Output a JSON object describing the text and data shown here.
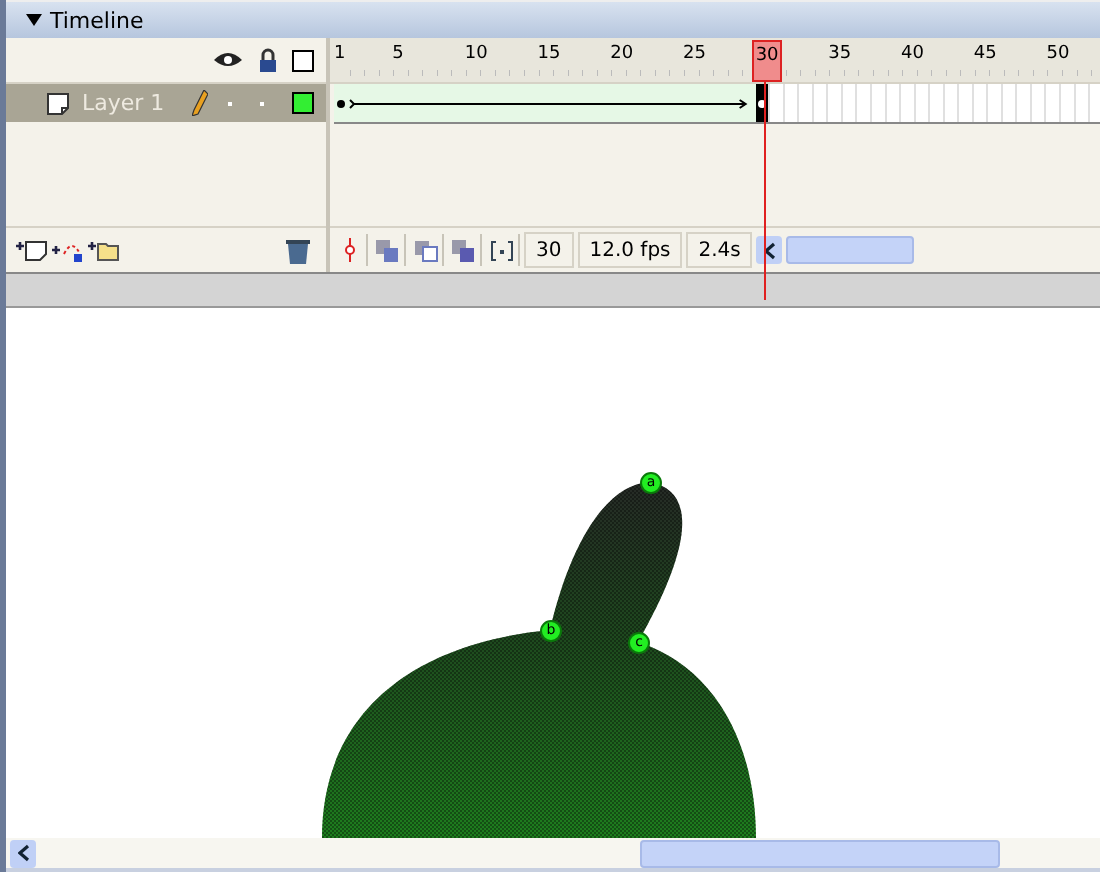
{
  "panel": {
    "title": "Timeline",
    "expanded": true
  },
  "layers": [
    {
      "name": "Layer 1",
      "selected": true,
      "color": "#33ee33",
      "tween": true
    }
  ],
  "ruler": {
    "labels": [
      "1",
      "5",
      "10",
      "15",
      "20",
      "25",
      "35",
      "40",
      "45",
      "50"
    ]
  },
  "playhead": {
    "label": "30"
  },
  "status": {
    "current_frame": "30",
    "frame_rate": "12.0 fps",
    "elapsed": "2.4s"
  },
  "stage": {
    "hints": [
      "a",
      "b",
      "c"
    ]
  }
}
